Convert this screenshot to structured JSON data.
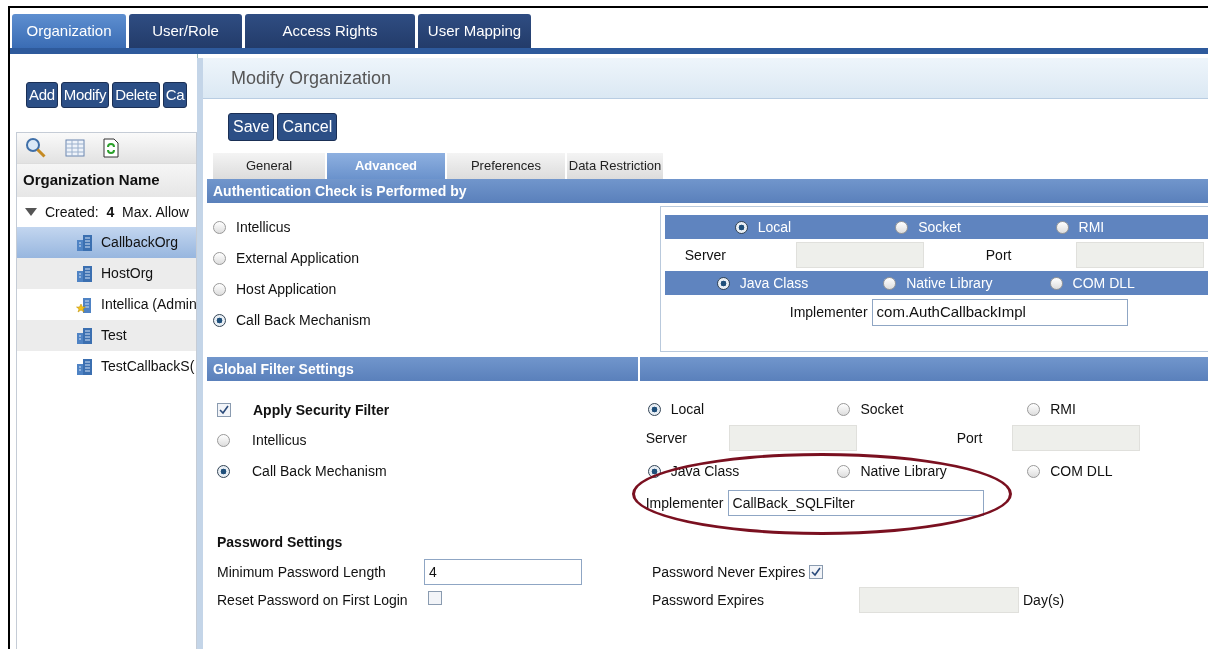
{
  "main_tabs": [
    {
      "label": "Organization",
      "selected": true
    },
    {
      "label": "User/Role",
      "selected": false
    },
    {
      "label": "Access Rights",
      "selected": false
    },
    {
      "label": "User Mapping",
      "selected": false
    }
  ],
  "left_panel": {
    "buttons": [
      "Add",
      "Modify",
      "Delete",
      "Ca"
    ],
    "column_header": "Organization Name",
    "tree": {
      "label": "Created:  **4**  Max. Allow",
      "expanded": true,
      "children": [
        {
          "label": "CallbackOrg",
          "kind": "org",
          "selected": true
        },
        {
          "label": "HostOrg",
          "kind": "org",
          "selected": false
        },
        {
          "label": "Intellica (Admin",
          "kind": "admin",
          "selected": false
        },
        {
          "label": "Test",
          "kind": "org",
          "selected": false
        },
        {
          "label": "TestCallbackS(",
          "kind": "org",
          "selected": false
        }
      ]
    }
  },
  "dialog": {
    "title": "Modify Organization",
    "buttons": [
      "Save",
      "Cancel"
    ],
    "tabs": [
      {
        "label": "General",
        "selected": false
      },
      {
        "label": "Advanced",
        "selected": true
      },
      {
        "label": "Preferences",
        "selected": false
      },
      {
        "label": "Data Restriction",
        "selected": false
      }
    ],
    "authentication": {
      "heading": "Authentication Check is Performed by",
      "options": [
        {
          "label": "Intellicus",
          "selected": false
        },
        {
          "label": "External Application",
          "selected": false
        },
        {
          "label": "Host Application",
          "selected": false
        },
        {
          "label": "Call Back Mechanism",
          "selected": true
        }
      ],
      "server_types": [
        {
          "label": "Local",
          "selected": true
        },
        {
          "label": "Socket",
          "selected": false
        },
        {
          "label": "RMI",
          "selected": false
        }
      ],
      "server_label": "Server",
      "port_label": "Port",
      "implementation_types": [
        {
          "label": "Java Class",
          "selected": true
        },
        {
          "label": "Native Library",
          "selected": false
        },
        {
          "label": "COM DLL",
          "selected": false
        }
      ],
      "implementer_label": "Implementer",
      "implementer_value": "com.AuthCallbackImpl"
    },
    "global_filter": {
      "heading": "Global Filter Settings",
      "apply_security_filter": {
        "label": "Apply Security Filter",
        "checked": true
      },
      "options": [
        {
          "label": "Intellicus",
          "selected": false
        },
        {
          "label": "Call Back Mechanism",
          "selected": true
        }
      ],
      "server_types": [
        {
          "label": "Local",
          "selected": true
        },
        {
          "label": "Socket",
          "selected": false
        },
        {
          "label": "RMI",
          "selected": false
        }
      ],
      "server_label": "Server",
      "port_label": "Port",
      "implementation_types": [
        {
          "label": "Java Class",
          "selected": true
        },
        {
          "label": "Native Library",
          "selected": false
        },
        {
          "label": "COM DLL",
          "selected": false
        }
      ],
      "implementer_label": "Implementer",
      "implementer_value": "CallBack_SQLFilter"
    },
    "password": {
      "heading": "Password Settings",
      "min_length": {
        "label": "Minimum Password Length",
        "value": "4"
      },
      "reset_on_first_login": {
        "label": "Reset Password on First Login",
        "checked": false
      },
      "never_expires": {
        "label": "Password Never Expires",
        "checked": true
      },
      "expires": {
        "label": "Password Expires",
        "unit": "Day(s)"
      }
    }
  }
}
